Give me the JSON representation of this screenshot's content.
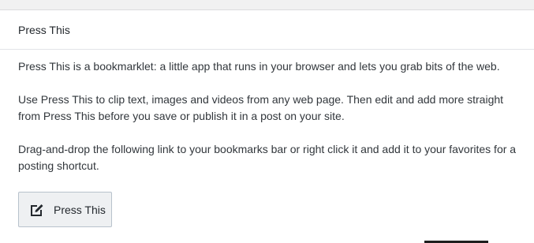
{
  "panel": {
    "title": "Press This"
  },
  "content": {
    "intro": "Press This is a bookmarklet: a little app that runs in your browser and lets you grab bits of the web.",
    "usage": "Use Press This to clip text, images and videos from any web page. Then edit and add more straight from Press This before you save or publish it in a post on your site.",
    "instructions": "Drag-and-drop the following link to your bookmarks bar or right click it and add it to your favorites for a posting shortcut."
  },
  "bookmarklet": {
    "label": "Press This",
    "icon": "edit-icon"
  },
  "colors": {
    "text": "#32373c",
    "button_bg": "#eef0f2",
    "button_border": "#b8c2cc"
  }
}
